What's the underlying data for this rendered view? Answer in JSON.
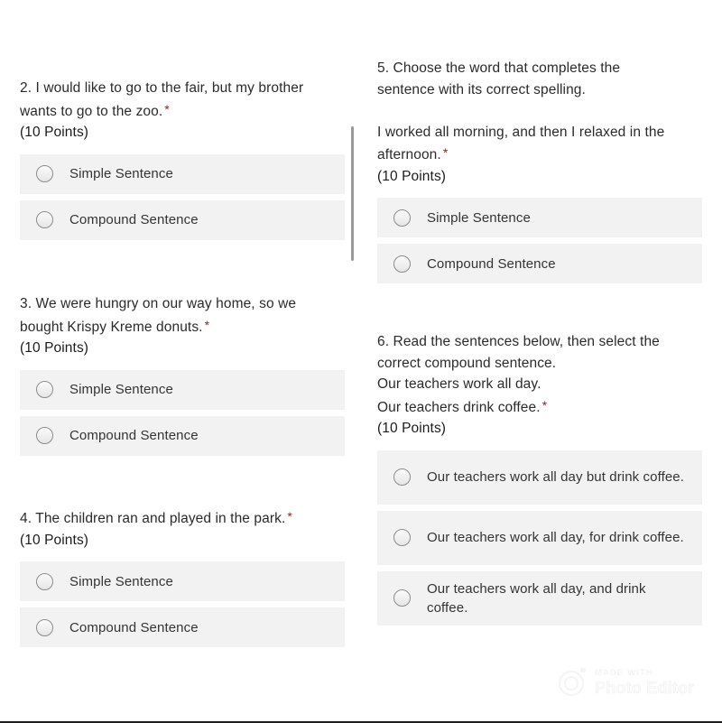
{
  "form": {
    "required_marker": "*",
    "questions": [
      {
        "id": "q2",
        "lines": [
          "2. I would like to go to the fair, but my brother",
          "wants to go to the zoo."
        ],
        "points": "(10 Points)",
        "options": [
          {
            "label": "Simple Sentence"
          },
          {
            "label": "Compound Sentence"
          }
        ]
      },
      {
        "id": "q3",
        "lines": [
          "3. We were hungry on our way home, so we",
          "bought Krispy Kreme donuts."
        ],
        "points": "(10 Points)",
        "options": [
          {
            "label": "Simple Sentence"
          },
          {
            "label": "Compound Sentence"
          }
        ]
      },
      {
        "id": "q4",
        "lines": [
          "4. The children ran and played in the park."
        ],
        "points": "(10 Points)",
        "options": [
          {
            "label": "Simple Sentence"
          },
          {
            "label": "Compound Sentence"
          }
        ]
      },
      {
        "id": "q5",
        "lines": [
          "5. Choose the word that completes the",
          "sentence with its correct spelling.",
          "",
          "I worked all morning, and then I relaxed in the",
          "afternoon."
        ],
        "points": "(10 Points)",
        "options": [
          {
            "label": "Simple Sentence"
          },
          {
            "label": "Compound Sentence"
          }
        ]
      },
      {
        "id": "q6",
        "lines": [
          "6. Read the sentences below, then select the",
          "correct compound sentence.",
          "Our teachers work all day.",
          "Our teachers drink coffee."
        ],
        "points": "(10 Points)",
        "options": [
          {
            "label": "Our teachers work all day but drink coffee."
          },
          {
            "label": "Our teachers work all day, for drink coffee."
          },
          {
            "label": "Our teachers work all day, and drink coffee."
          }
        ]
      }
    ]
  },
  "watermark": {
    "made_with": "MADE WITH",
    "app_name": "Photo Editor"
  },
  "colors": {
    "required_asterisk": "#8d2b20",
    "option_background": "#f2f2f2",
    "text": "#2b2b2b",
    "scrollbar_thumb": "#9a9a9a"
  }
}
